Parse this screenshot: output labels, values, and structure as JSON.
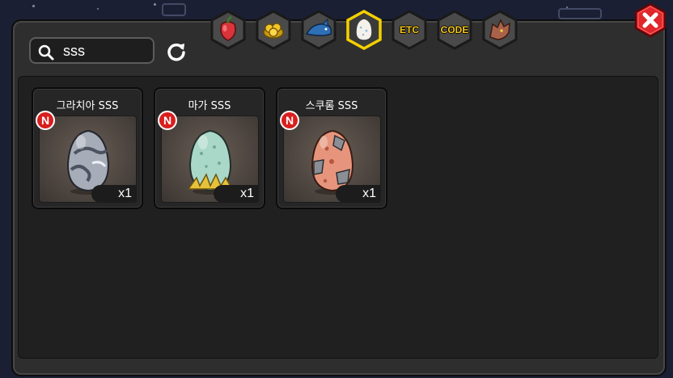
{
  "search": {
    "value": "sss",
    "icon": "search-icon"
  },
  "refresh": {
    "icon": "refresh-icon"
  },
  "tabs": [
    {
      "id": "fruit",
      "icon": "fruit-icon",
      "label": ""
    },
    {
      "id": "gold",
      "icon": "gold-coins-icon",
      "label": ""
    },
    {
      "id": "monster",
      "icon": "blue-creature-icon",
      "label": ""
    },
    {
      "id": "egg",
      "icon": "egg-icon",
      "label": "",
      "active": true
    },
    {
      "id": "etc",
      "icon": "",
      "label": "ETC"
    },
    {
      "id": "code",
      "icon": "",
      "label": "CODE"
    },
    {
      "id": "dragon",
      "icon": "dragon-head-icon",
      "label": ""
    }
  ],
  "close": {
    "icon": "close-icon"
  },
  "items": [
    {
      "name": "그라치아 SSS",
      "quantity": "x1",
      "badge": "N",
      "egg_color": "#9aa0ad",
      "egg_pattern": "swirl"
    },
    {
      "name": "마가 SSS",
      "quantity": "x1",
      "badge": "N",
      "egg_color": "#a8d6c8",
      "egg_pattern": "grass"
    },
    {
      "name": "스쿠롬 SSS",
      "quantity": "x1",
      "badge": "N",
      "egg_color": "#e6957c",
      "egg_pattern": "armored"
    }
  ],
  "colors": {
    "accent_yellow": "#f5c71a",
    "badge_red": "#d91e1e",
    "close_red": "#e0262b",
    "panel": "#2e2e2e"
  }
}
